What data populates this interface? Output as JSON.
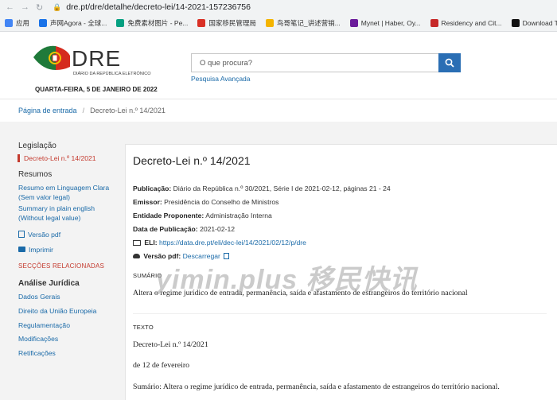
{
  "browser": {
    "url": "dre.pt/dre/detalhe/decreto-lei/14-2021-157236756",
    "bookmarks": [
      {
        "label": "应用",
        "color": "#4285f4"
      },
      {
        "label": "声网Agora - 全球...",
        "color": "#1a73e8"
      },
      {
        "label": "免费素材图片 - Pe...",
        "color": "#05a081"
      },
      {
        "label": "国家移民管理局",
        "color": "#d93025"
      },
      {
        "label": "鸟哥笔记_讲述营销...",
        "color": "#f4b400"
      },
      {
        "label": "Mynet | Haber, Oy...",
        "color": "#6a1b9a"
      },
      {
        "label": "Residency and Cit...",
        "color": "#c62828"
      },
      {
        "label": "Download TikTok...",
        "color": "#111111"
      }
    ]
  },
  "header": {
    "logo_text": "DRE",
    "logo_subtitle": "DIÁRIO DA REPÚBLICA ELETRÓNICO",
    "date": "QUARTA-FEIRA, 5 DE JANEIRO DE 2022",
    "search_placeholder": "O que procura?",
    "advanced_search": "Pesquisa Avançada",
    "search_icon": "search-icon"
  },
  "breadcrumb": {
    "home": "Página de entrada",
    "separator": "/",
    "current": "Decreto-Lei n.º 14/2021"
  },
  "sidebar": {
    "legislacao_heading": "Legislação",
    "active_item": "Decreto-Lei n.º 14/2021",
    "resumos_heading": "Resumos",
    "resumo_pt": "Resumo em Linguagem Clara",
    "resumo_pt_note": "(Sem valor legal)",
    "resumo_en": "Summary in plain english",
    "resumo_en_note": "(Without legal value)",
    "pdf_version": "Versão pdf",
    "print": "Imprimir",
    "related_sections": "SECÇÕES RELACIONADAS",
    "legal_analysis_heading": "Análise Jurídica",
    "legal_links": [
      "Dados Gerais",
      "Direito da União Europeia",
      "Regulamentação",
      "Modificações",
      "Retificações"
    ]
  },
  "document": {
    "title": "Decreto-Lei n.º 14/2021",
    "publicacao_label": "Publicação:",
    "publicacao_value": "Diário da República n.º 30/2021, Série I de 2021-02-12, páginas 21 - 24",
    "emissor_label": "Emissor:",
    "emissor_value": "Presidência do Conselho de Ministros",
    "entidade_label": "Entidade Proponente:",
    "entidade_value": "Administração Interna",
    "data_label": "Data de Publicação:",
    "data_value": "2021-02-12",
    "eli_label": "ELI:",
    "eli_value": "https://data.dre.pt/eli/dec-lei/14/2021/02/12/p/dre",
    "pdf_label": "Versão pdf:",
    "pdf_link": "Descarregar",
    "sumario_heading": "SUMÁRIO",
    "sumario_text": "Altera o regime jurídico de entrada, permanência, saída e afastamento de estrangeiros do território nacional",
    "texto_heading": "TEXTO",
    "texto_line1": "Decreto-Lei n.º 14/2021",
    "texto_line2": "de 12 de fevereiro",
    "texto_line3": "Sumário: Altera o regime jurídico de entrada, permanência, saída e afastamento de estrangeiros do território nacional."
  },
  "watermark": "yimin.plus 移民快讯"
}
